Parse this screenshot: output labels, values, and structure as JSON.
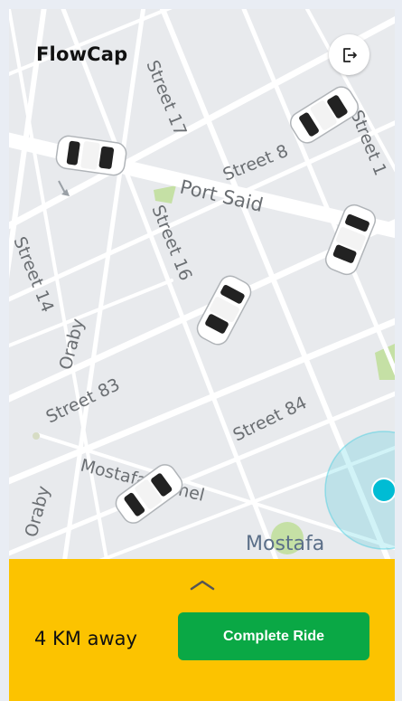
{
  "app": {
    "name": "FlowCap"
  },
  "header": {
    "logout_icon": "logout-icon"
  },
  "map": {
    "street_labels": [
      "Street 17",
      "Street 8",
      "Street 1",
      "Port Said",
      "Street 16",
      "Street 14",
      "Oraby",
      "Street 83",
      "Street 84",
      "Mostafa Kamel",
      "Oraby",
      "Mostafa"
    ],
    "colors": {
      "background": "#e8eaed",
      "road": "#ffffff",
      "park": "#c5e0a5",
      "location_accent": "#00bcd4"
    }
  },
  "bottom_panel": {
    "expand_icon": "chevron-up-icon",
    "distance_text": "4 KM away",
    "complete_ride_label": "Complete Ride",
    "colors": {
      "panel_background": "#fcc300",
      "button_background": "#0aa845",
      "button_text": "#ffffff"
    }
  }
}
